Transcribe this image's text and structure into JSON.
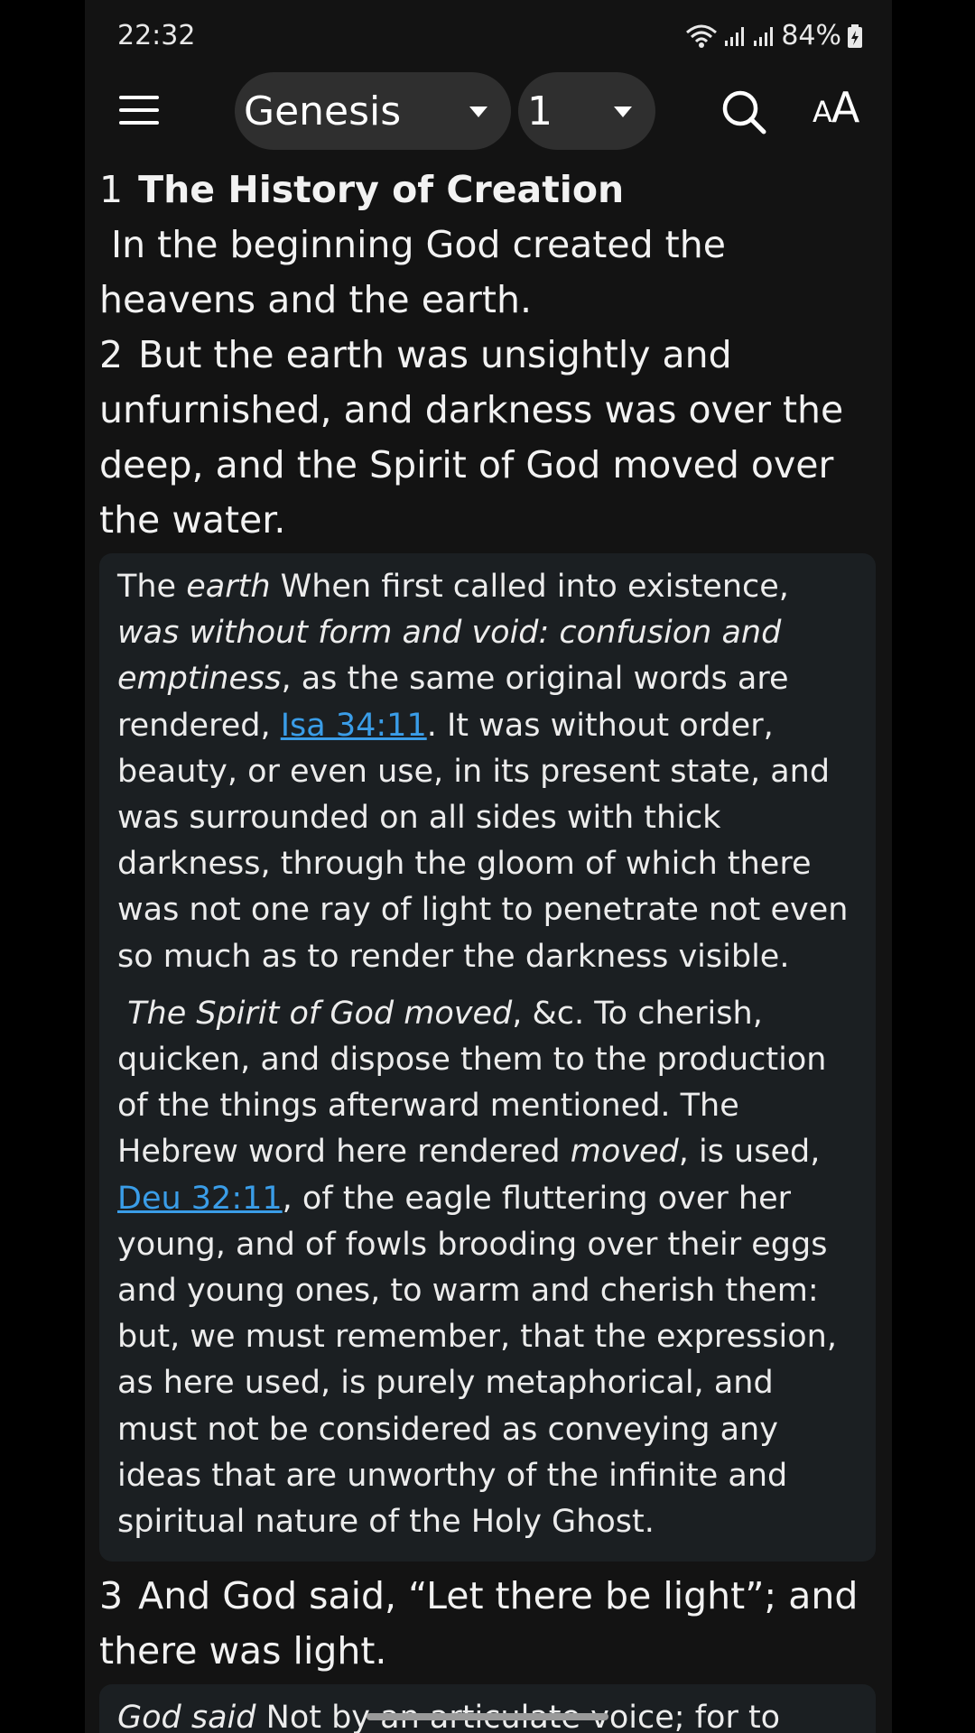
{
  "status_bar": {
    "time": "22:32",
    "battery": "84%"
  },
  "app_bar": {
    "book": "Genesis",
    "chapter": "1",
    "font_button_small": "A",
    "font_button_large": "A"
  },
  "verses": {
    "v1": {
      "number": "1",
      "heading": "The History of Creation",
      "text": "In the beginning God created the heavens and the earth."
    },
    "v2": {
      "number": "2",
      "text": "But the earth was unsightly and unfurnished, and darkness was over the deep, and the Spirit of God moved over the water."
    },
    "v3": {
      "number": "3",
      "text": "And God said, “Let there be light”; and there was light."
    }
  },
  "commentary_1": {
    "p1_a": "The ",
    "p1_b": "earth",
    "p1_c": " When first called into existence, ",
    "p1_d": "was without form and void: confusion and emptiness",
    "p1_e": ", as the same original words are rendered, ",
    "p1_link": "Isa 34:11",
    "p1_f": ". It was without order, beauty, or even use, in its present state, and was surrounded on all sides with thick darkness, through the gloom of which there was not one ray of light to penetrate not even so much as to render the darkness visible.",
    "p2_a": "The Spirit of God moved",
    "p2_b": ", &c. To cherish, quicken, and dispose them to the production of the things afterward mentioned. The Hebrew word here rendered ",
    "p2_c": "moved",
    "p2_d": ", is used, ",
    "p2_link": "Deu 32:11",
    "p2_e": ", of the eagle fluttering over her young, and of fowls brooding over their eggs and young ones, to warm and cherish them: but, we must remember, that the expression, as here used, is purely metaphorical, and must not be considered as conveying any ideas that are unworthy of the infinite and spiritual nature of the Holy Ghost."
  },
  "commentary_2": {
    "a": "God said",
    "b": " Not by an articulate voice; for to whom"
  },
  "colors": {
    "background": "#131313",
    "commentary_bg": "#1b1f22",
    "link": "#3a9de8",
    "pill": "#2f2f2f"
  },
  "icons": [
    "wifi-icon",
    "signal-icon",
    "battery-icon",
    "menu-icon",
    "caret-down-icon",
    "search-icon"
  ]
}
